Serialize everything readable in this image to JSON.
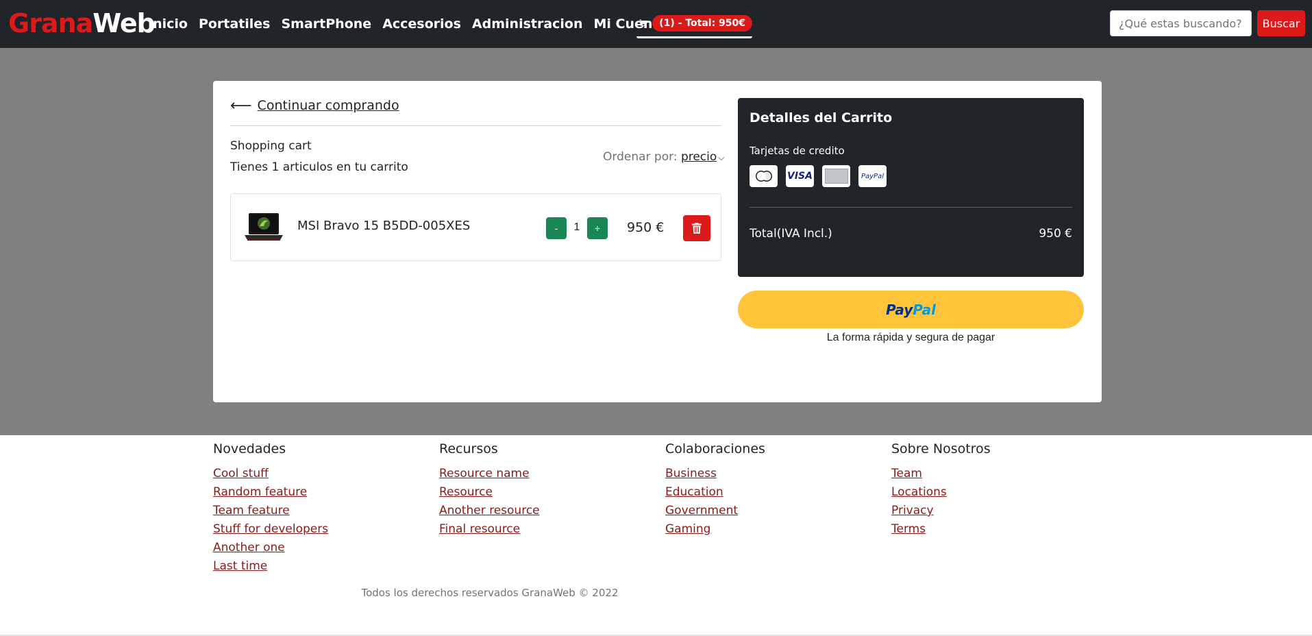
{
  "navbar": {
    "brand_part1": "Grana",
    "brand_part2": "Web",
    "links": [
      "Inicio",
      "Portatiles",
      "SmartPhone",
      "Accesorios",
      "Administracion",
      "Mi Cuenta"
    ],
    "cart_badge": "(1) - Total: 950€",
    "search_placeholder": "¿Qué estas buscando?",
    "search_button": "Buscar"
  },
  "cart": {
    "continue_label": "Continuar comprando",
    "title": "Shopping cart",
    "count_text": "Tienes 1 articulos en tu carrito",
    "sort_label": "Ordenar por:",
    "sort_value": "precio",
    "items": [
      {
        "name": "MSI Bravo 15 B5DD-005XES",
        "quantity": "1",
        "price": "950 €",
        "minus": "-",
        "plus": "+"
      }
    ]
  },
  "details": {
    "title": "Detalles del Carrito",
    "cards_label": "Tarjetas de credito",
    "card_icons": [
      "mastercard-icon",
      "visa-icon",
      "amex-icon",
      "paypal-icon"
    ],
    "visa_text": "VISA",
    "paypal_text": "PayPal",
    "total_label": "Total(IVA Incl.)",
    "total_value": "950 €"
  },
  "paypal": {
    "button_part1": "Pay",
    "button_part2": "Pal",
    "tagline": "La forma rápida y segura de pagar"
  },
  "footer": {
    "columns": [
      {
        "title": "Novedades",
        "links": [
          "Cool stuff",
          "Random feature",
          "Team feature",
          "Stuff for developers",
          "Another one",
          "Last time"
        ]
      },
      {
        "title": "Recursos",
        "links": [
          "Resource name",
          "Resource",
          "Another resource",
          "Final resource"
        ]
      },
      {
        "title": "Colaboraciones",
        "links": [
          "Business",
          "Education",
          "Government",
          "Gaming"
        ]
      },
      {
        "title": "Sobre Nosotros",
        "links": [
          "Team",
          "Locations",
          "Privacy",
          "Terms"
        ]
      }
    ],
    "copyright": "Todos los derechos reservados GranaWeb © 2022"
  },
  "colors": {
    "navbar_bg": "#212529",
    "brand_red": "#dc1a1a",
    "success_green": "#198754",
    "paypal_yellow": "#ffc439",
    "link_maroon": "#8b1a1a",
    "gray_band": "#808080"
  }
}
